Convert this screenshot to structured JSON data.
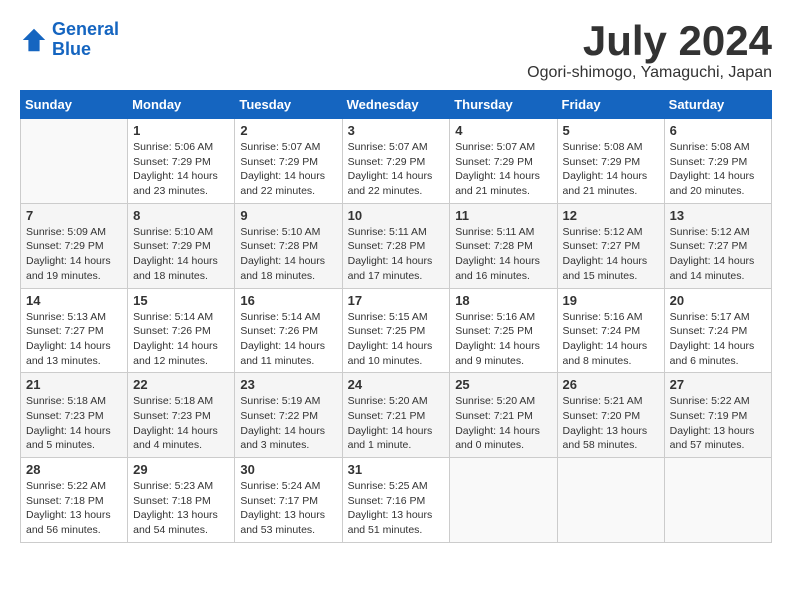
{
  "header": {
    "logo_line1": "General",
    "logo_line2": "Blue",
    "title": "July 2024",
    "subtitle": "Ogori-shimogo, Yamaguchi, Japan"
  },
  "weekdays": [
    "Sunday",
    "Monday",
    "Tuesday",
    "Wednesday",
    "Thursday",
    "Friday",
    "Saturday"
  ],
  "weeks": [
    [
      {
        "day": "",
        "sunrise": "",
        "sunset": "",
        "daylight": ""
      },
      {
        "day": "1",
        "sunrise": "Sunrise: 5:06 AM",
        "sunset": "Sunset: 7:29 PM",
        "daylight": "Daylight: 14 hours and 23 minutes."
      },
      {
        "day": "2",
        "sunrise": "Sunrise: 5:07 AM",
        "sunset": "Sunset: 7:29 PM",
        "daylight": "Daylight: 14 hours and 22 minutes."
      },
      {
        "day": "3",
        "sunrise": "Sunrise: 5:07 AM",
        "sunset": "Sunset: 7:29 PM",
        "daylight": "Daylight: 14 hours and 22 minutes."
      },
      {
        "day": "4",
        "sunrise": "Sunrise: 5:07 AM",
        "sunset": "Sunset: 7:29 PM",
        "daylight": "Daylight: 14 hours and 21 minutes."
      },
      {
        "day": "5",
        "sunrise": "Sunrise: 5:08 AM",
        "sunset": "Sunset: 7:29 PM",
        "daylight": "Daylight: 14 hours and 21 minutes."
      },
      {
        "day": "6",
        "sunrise": "Sunrise: 5:08 AM",
        "sunset": "Sunset: 7:29 PM",
        "daylight": "Daylight: 14 hours and 20 minutes."
      }
    ],
    [
      {
        "day": "7",
        "sunrise": "Sunrise: 5:09 AM",
        "sunset": "Sunset: 7:29 PM",
        "daylight": "Daylight: 14 hours and 19 minutes."
      },
      {
        "day": "8",
        "sunrise": "Sunrise: 5:10 AM",
        "sunset": "Sunset: 7:29 PM",
        "daylight": "Daylight: 14 hours and 18 minutes."
      },
      {
        "day": "9",
        "sunrise": "Sunrise: 5:10 AM",
        "sunset": "Sunset: 7:28 PM",
        "daylight": "Daylight: 14 hours and 18 minutes."
      },
      {
        "day": "10",
        "sunrise": "Sunrise: 5:11 AM",
        "sunset": "Sunset: 7:28 PM",
        "daylight": "Daylight: 14 hours and 17 minutes."
      },
      {
        "day": "11",
        "sunrise": "Sunrise: 5:11 AM",
        "sunset": "Sunset: 7:28 PM",
        "daylight": "Daylight: 14 hours and 16 minutes."
      },
      {
        "day": "12",
        "sunrise": "Sunrise: 5:12 AM",
        "sunset": "Sunset: 7:27 PM",
        "daylight": "Daylight: 14 hours and 15 minutes."
      },
      {
        "day": "13",
        "sunrise": "Sunrise: 5:12 AM",
        "sunset": "Sunset: 7:27 PM",
        "daylight": "Daylight: 14 hours and 14 minutes."
      }
    ],
    [
      {
        "day": "14",
        "sunrise": "Sunrise: 5:13 AM",
        "sunset": "Sunset: 7:27 PM",
        "daylight": "Daylight: 14 hours and 13 minutes."
      },
      {
        "day": "15",
        "sunrise": "Sunrise: 5:14 AM",
        "sunset": "Sunset: 7:26 PM",
        "daylight": "Daylight: 14 hours and 12 minutes."
      },
      {
        "day": "16",
        "sunrise": "Sunrise: 5:14 AM",
        "sunset": "Sunset: 7:26 PM",
        "daylight": "Daylight: 14 hours and 11 minutes."
      },
      {
        "day": "17",
        "sunrise": "Sunrise: 5:15 AM",
        "sunset": "Sunset: 7:25 PM",
        "daylight": "Daylight: 14 hours and 10 minutes."
      },
      {
        "day": "18",
        "sunrise": "Sunrise: 5:16 AM",
        "sunset": "Sunset: 7:25 PM",
        "daylight": "Daylight: 14 hours and 9 minutes."
      },
      {
        "day": "19",
        "sunrise": "Sunrise: 5:16 AM",
        "sunset": "Sunset: 7:24 PM",
        "daylight": "Daylight: 14 hours and 8 minutes."
      },
      {
        "day": "20",
        "sunrise": "Sunrise: 5:17 AM",
        "sunset": "Sunset: 7:24 PM",
        "daylight": "Daylight: 14 hours and 6 minutes."
      }
    ],
    [
      {
        "day": "21",
        "sunrise": "Sunrise: 5:18 AM",
        "sunset": "Sunset: 7:23 PM",
        "daylight": "Daylight: 14 hours and 5 minutes."
      },
      {
        "day": "22",
        "sunrise": "Sunrise: 5:18 AM",
        "sunset": "Sunset: 7:23 PM",
        "daylight": "Daylight: 14 hours and 4 minutes."
      },
      {
        "day": "23",
        "sunrise": "Sunrise: 5:19 AM",
        "sunset": "Sunset: 7:22 PM",
        "daylight": "Daylight: 14 hours and 3 minutes."
      },
      {
        "day": "24",
        "sunrise": "Sunrise: 5:20 AM",
        "sunset": "Sunset: 7:21 PM",
        "daylight": "Daylight: 14 hours and 1 minute."
      },
      {
        "day": "25",
        "sunrise": "Sunrise: 5:20 AM",
        "sunset": "Sunset: 7:21 PM",
        "daylight": "Daylight: 14 hours and 0 minutes."
      },
      {
        "day": "26",
        "sunrise": "Sunrise: 5:21 AM",
        "sunset": "Sunset: 7:20 PM",
        "daylight": "Daylight: 13 hours and 58 minutes."
      },
      {
        "day": "27",
        "sunrise": "Sunrise: 5:22 AM",
        "sunset": "Sunset: 7:19 PM",
        "daylight": "Daylight: 13 hours and 57 minutes."
      }
    ],
    [
      {
        "day": "28",
        "sunrise": "Sunrise: 5:22 AM",
        "sunset": "Sunset: 7:18 PM",
        "daylight": "Daylight: 13 hours and 56 minutes."
      },
      {
        "day": "29",
        "sunrise": "Sunrise: 5:23 AM",
        "sunset": "Sunset: 7:18 PM",
        "daylight": "Daylight: 13 hours and 54 minutes."
      },
      {
        "day": "30",
        "sunrise": "Sunrise: 5:24 AM",
        "sunset": "Sunset: 7:17 PM",
        "daylight": "Daylight: 13 hours and 53 minutes."
      },
      {
        "day": "31",
        "sunrise": "Sunrise: 5:25 AM",
        "sunset": "Sunset: 7:16 PM",
        "daylight": "Daylight: 13 hours and 51 minutes."
      },
      {
        "day": "",
        "sunrise": "",
        "sunset": "",
        "daylight": ""
      },
      {
        "day": "",
        "sunrise": "",
        "sunset": "",
        "daylight": ""
      },
      {
        "day": "",
        "sunrise": "",
        "sunset": "",
        "daylight": ""
      }
    ]
  ]
}
